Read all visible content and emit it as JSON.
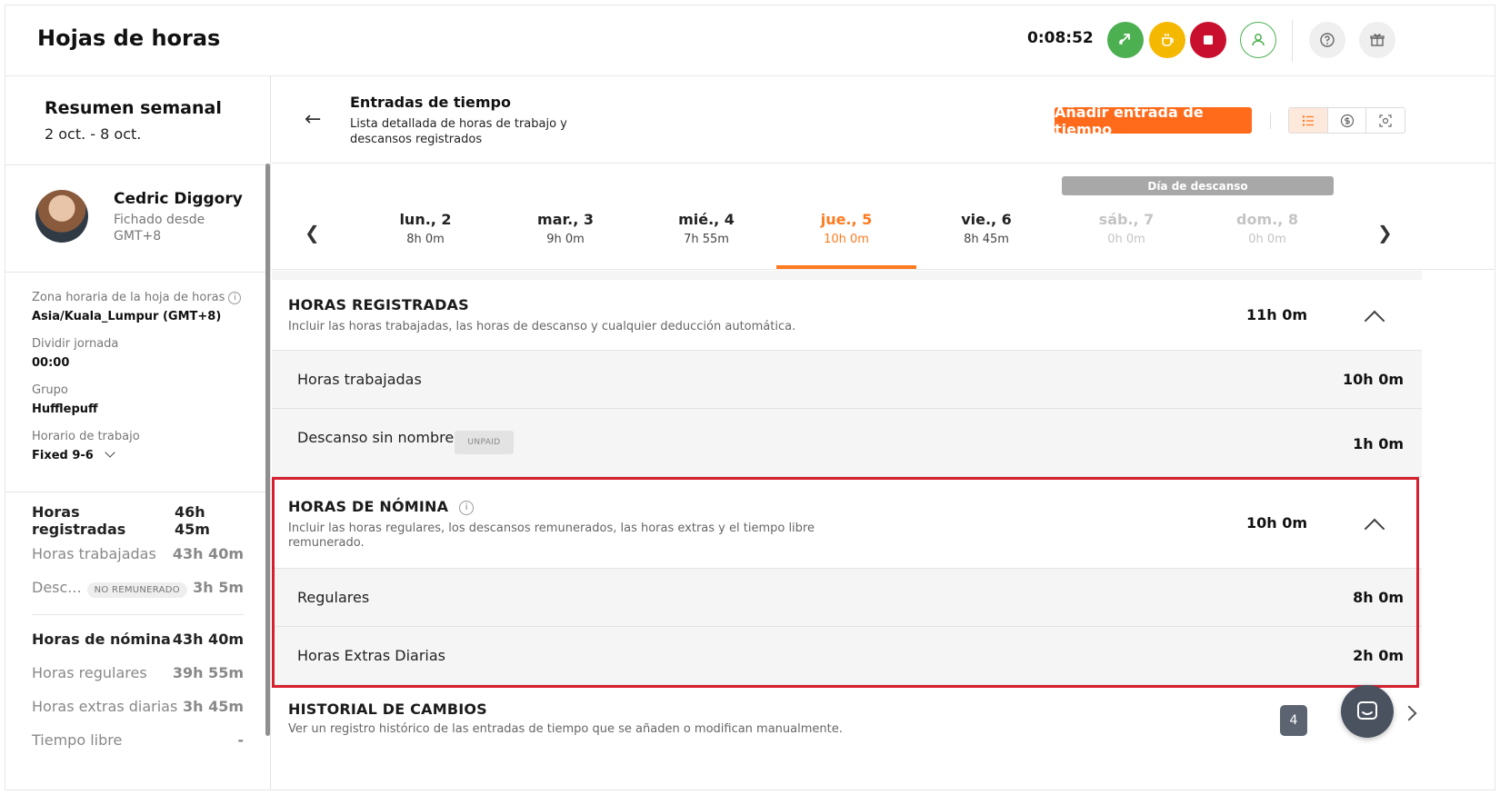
{
  "header": {
    "title": "Hojas de horas",
    "timer": "0:08:52",
    "icons": {
      "transfer": "transfer-icon",
      "break": "coffee-break-icon",
      "stop": "stop-icon",
      "profile": "user-profile-icon",
      "help": "help-icon",
      "gift": "gift-icon"
    },
    "colors": {
      "transfer": "#4caf50",
      "break": "#f5b800",
      "stop": "#c8102e"
    }
  },
  "sidebar": {
    "summary_title": "Resumen semanal",
    "summary_range": "2 oct. - 8 oct.",
    "user": {
      "name": "Cedric Diggory",
      "clocked_from": "Fichado desde",
      "timezone": "GMT+8"
    },
    "details": [
      {
        "label": "Zona horaria de la hoja de horas",
        "value": "Asia/Kuala_Lumpur (GMT+8)"
      },
      {
        "label": "Dividir jornada",
        "value": "00:00"
      },
      {
        "label": "Grupo",
        "value": "Hufflepuff"
      },
      {
        "label": "Horario de trabajo",
        "value": "Fixed 9-6"
      }
    ],
    "stats_group1": [
      {
        "label": "Horas registradas",
        "value": "46h 45m"
      },
      {
        "label": "Horas trabajadas",
        "value": "43h 40m"
      },
      {
        "label": "Desc...",
        "badge": "NO REMUNERADO",
        "value": "3h 5m"
      }
    ],
    "stats_group2": [
      {
        "label": "Horas de nómina",
        "value": "43h 40m"
      },
      {
        "label": "Horas regulares",
        "value": "39h 55m"
      },
      {
        "label": "Horas extras diarias",
        "value": "3h 45m"
      },
      {
        "label": "Tiempo libre",
        "value": "-"
      }
    ]
  },
  "entries": {
    "title": "Entradas de tiempo",
    "subtitle": "Lista detallada de horas de trabajo y descansos registrados",
    "add_button": "Añadir entrada de tiempo",
    "accent": "#ff6b1a"
  },
  "days": {
    "rest_badge": "Día de descanso",
    "items": [
      {
        "name": "lun., 2",
        "hours": "8h 0m"
      },
      {
        "name": "mar., 3",
        "hours": "9h 0m"
      },
      {
        "name": "mié., 4",
        "hours": "7h 55m"
      },
      {
        "name": "jue., 5",
        "hours": "10h 0m"
      },
      {
        "name": "vie., 6",
        "hours": "8h 45m"
      },
      {
        "name": "sáb., 7",
        "hours": "0h 0m"
      },
      {
        "name": "dom., 8",
        "hours": "0h 0m"
      }
    ],
    "selected_index": 3
  },
  "registered": {
    "title": "HORAS REGISTRADAS",
    "desc": "Incluir las horas trabajadas, las horas de descanso y cualquier deducción automática.",
    "total": "11h 0m",
    "rows": [
      {
        "label": "Horas trabajadas",
        "value": "10h 0m"
      },
      {
        "label": "Descanso sin nombre",
        "badge": "UNPAID",
        "value": "1h 0m"
      }
    ]
  },
  "payroll": {
    "title": "HORAS DE NÓMINA",
    "desc": "Incluir las horas regulares, los descansos remunerados, las horas extras y el tiempo libre remunerado.",
    "total": "10h 0m",
    "rows": [
      {
        "label": "Regulares",
        "value": "8h 0m"
      },
      {
        "label": "Horas Extras Diarias",
        "value": "2h 0m"
      }
    ],
    "highlight_color": "#d6202f"
  },
  "history": {
    "title": "HISTORIAL DE CAMBIOS",
    "desc": "Ver un registro histórico de las entradas de tiempo que se añaden o modifican manualmente.",
    "count": "4"
  }
}
